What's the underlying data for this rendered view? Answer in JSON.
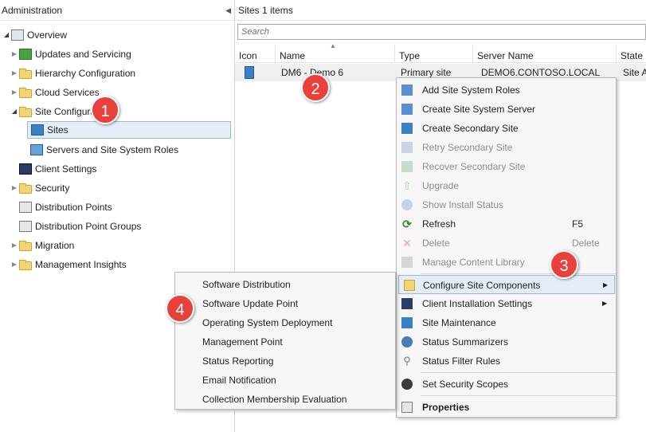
{
  "nav": {
    "title": "Administration",
    "collapse_glyph": "◀",
    "items": [
      {
        "label": "Overview",
        "icon": "overview-icon",
        "expanded": true
      },
      {
        "label": "Updates and Servicing",
        "icon": "updates-icon"
      },
      {
        "label": "Hierarchy Configuration",
        "icon": "folder-icon"
      },
      {
        "label": "Cloud Services",
        "icon": "folder-icon"
      },
      {
        "label": "Site Configuration",
        "icon": "folder-icon",
        "expanded": true
      },
      {
        "label": "Sites",
        "icon": "sites-icon",
        "selected": true
      },
      {
        "label": "Servers and Site System Roles",
        "icon": "servers-icon"
      },
      {
        "label": "Client Settings",
        "icon": "client-settings-icon"
      },
      {
        "label": "Security",
        "icon": "folder-icon"
      },
      {
        "label": "Distribution Points",
        "icon": "distribution-points-icon"
      },
      {
        "label": "Distribution Point Groups",
        "icon": "distribution-point-groups-icon"
      },
      {
        "label": "Migration",
        "icon": "folder-icon"
      },
      {
        "label": "Management Insights",
        "icon": "folder-icon"
      }
    ]
  },
  "list": {
    "title": "Sites 1 items",
    "search_placeholder": "Search",
    "columns": [
      "Icon",
      "Name",
      "Type",
      "Server Name",
      "State"
    ],
    "rows": [
      {
        "name": "DM6 - Demo 6",
        "type": "Primary site",
        "server": "DEMO6.CONTOSO.LOCAL",
        "state": "Site A"
      }
    ]
  },
  "context_menu": {
    "items": [
      {
        "label": "Add Site System Roles",
        "icon": "add-roles-icon",
        "enabled": true
      },
      {
        "label": "Create Site System Server",
        "icon": "create-server-icon",
        "enabled": true
      },
      {
        "label": "Create Secondary Site",
        "icon": "create-secondary-icon",
        "enabled": true
      },
      {
        "label": "Retry Secondary Site",
        "icon": "retry-icon",
        "enabled": false
      },
      {
        "label": "Recover Secondary Site",
        "icon": "recover-icon",
        "enabled": false
      },
      {
        "label": "Upgrade",
        "icon": "upgrade-icon",
        "enabled": false
      },
      {
        "label": "Show Install Status",
        "icon": "install-status-icon",
        "enabled": false
      },
      {
        "label": "Refresh",
        "icon": "refresh-icon",
        "enabled": true,
        "shortcut": "F5"
      },
      {
        "label": "Delete",
        "icon": "delete-icon",
        "enabled": false,
        "shortcut": "Delete"
      },
      {
        "label": "Manage Content Library",
        "icon": "content-library-icon",
        "enabled": false
      },
      {
        "label": "Configure Site Components",
        "icon": "configure-icon",
        "enabled": true,
        "submenu": true,
        "highlighted": true
      },
      {
        "label": "Client Installation Settings",
        "icon": "client-install-icon",
        "enabled": true,
        "submenu": true
      },
      {
        "label": "Site Maintenance",
        "icon": "maintenance-icon",
        "enabled": true
      },
      {
        "label": "Status Summarizers",
        "icon": "summarizers-icon",
        "enabled": true
      },
      {
        "label": "Status Filter Rules",
        "icon": "filter-rules-icon",
        "enabled": true
      },
      {
        "label": "Set Security Scopes",
        "icon": "security-scopes-icon",
        "enabled": true
      },
      {
        "label": "Properties",
        "icon": "properties-icon",
        "enabled": true,
        "bold": true
      }
    ],
    "submenu_glyph": "▶"
  },
  "submenu": {
    "items": [
      "Software Distribution",
      "Software Update Point",
      "Operating System Deployment",
      "Management Point",
      "Status Reporting",
      "Email Notification",
      "Collection Membership Evaluation"
    ]
  },
  "badges": [
    "1",
    "2",
    "3",
    "4"
  ],
  "colors": {
    "badge": "#e8403b",
    "selection": "#e5eef8",
    "selection_border": "#99b9dd",
    "menu_bg": "#f7f7f7"
  }
}
